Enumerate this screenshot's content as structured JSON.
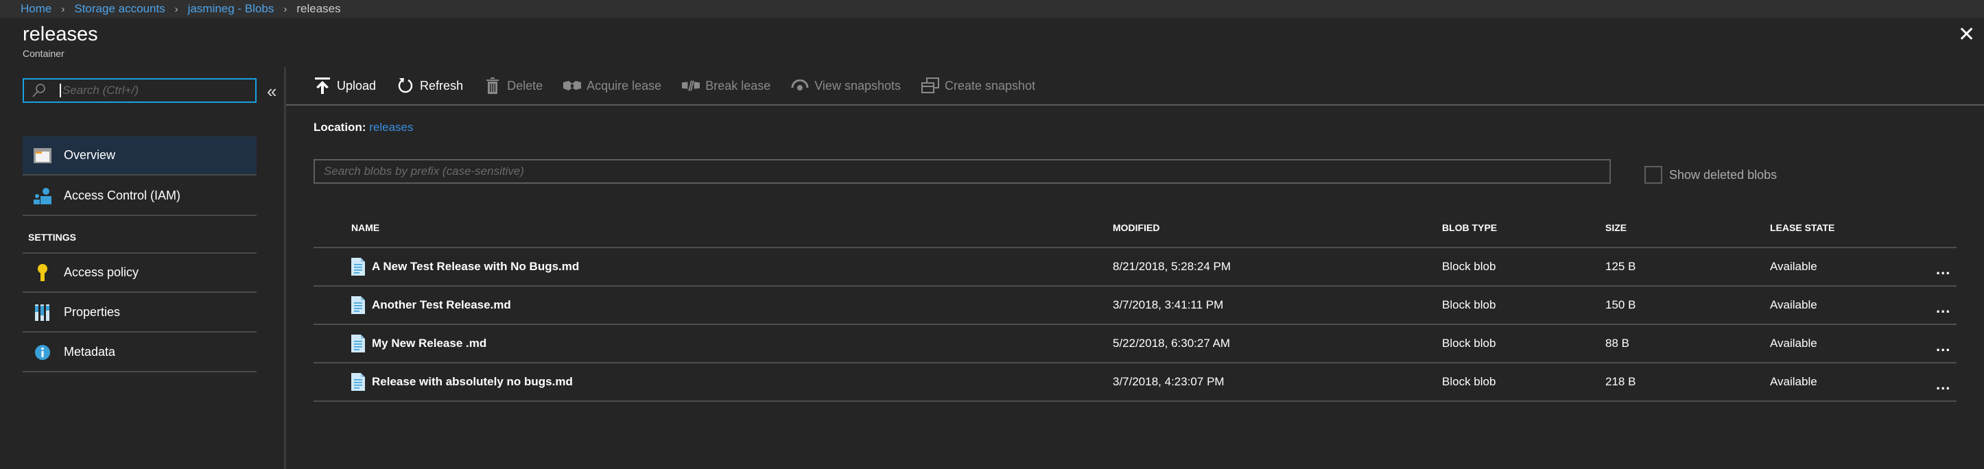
{
  "breadcrumb": [
    {
      "label": "Home"
    },
    {
      "label": "Storage accounts"
    },
    {
      "label": "jasmineg - Blobs"
    }
  ],
  "breadcrumb_current": "releases",
  "header": {
    "title": "releases",
    "subtitle": "Container"
  },
  "sidebar": {
    "search_placeholder": "Search (Ctrl+/)",
    "collapse_glyph": "«",
    "items": [
      {
        "label": "Overview",
        "icon": "container-icon",
        "active": true
      },
      {
        "label": "Access Control (IAM)",
        "icon": "iam-icon"
      }
    ],
    "settings_title": "SETTINGS",
    "settings_items": [
      {
        "label": "Access policy",
        "icon": "key-icon"
      },
      {
        "label": "Properties",
        "icon": "properties-icon"
      },
      {
        "label": "Metadata",
        "icon": "info-icon"
      }
    ]
  },
  "toolbar": {
    "upload": "Upload",
    "refresh": "Refresh",
    "delete": "Delete",
    "acquire_lease": "Acquire lease",
    "break_lease": "Break lease",
    "view_snapshots": "View snapshots",
    "create_snapshot": "Create snapshot"
  },
  "location": {
    "label": "Location:",
    "value": "releases"
  },
  "blob_search": {
    "placeholder": "Search blobs by prefix (case-sensitive)",
    "value": ""
  },
  "show_deleted": {
    "label": "Show deleted blobs",
    "checked": false
  },
  "table": {
    "columns": [
      "NAME",
      "MODIFIED",
      "BLOB TYPE",
      "SIZE",
      "LEASE STATE"
    ],
    "rows": [
      {
        "name": "A New Test Release with No Bugs.md",
        "modified": "8/21/2018, 5:28:24 PM",
        "type": "Block blob",
        "size": "125 B",
        "lease": "Available"
      },
      {
        "name": "Another Test Release.md",
        "modified": "3/7/2018, 3:41:11 PM",
        "type": "Block blob",
        "size": "150 B",
        "lease": "Available"
      },
      {
        "name": "My New Release .md",
        "modified": "5/22/2018, 6:30:27 AM",
        "type": "Block blob",
        "size": "88 B",
        "lease": "Available"
      },
      {
        "name": "Release with absolutely no bugs.md",
        "modified": "3/7/2018, 4:23:07 PM",
        "type": "Block blob",
        "size": "218 B",
        "lease": "Available"
      }
    ],
    "more_glyph": "..."
  },
  "colors": {
    "accent": "#1ba1e2",
    "link": "#4ea3e8",
    "background": "#252525"
  }
}
